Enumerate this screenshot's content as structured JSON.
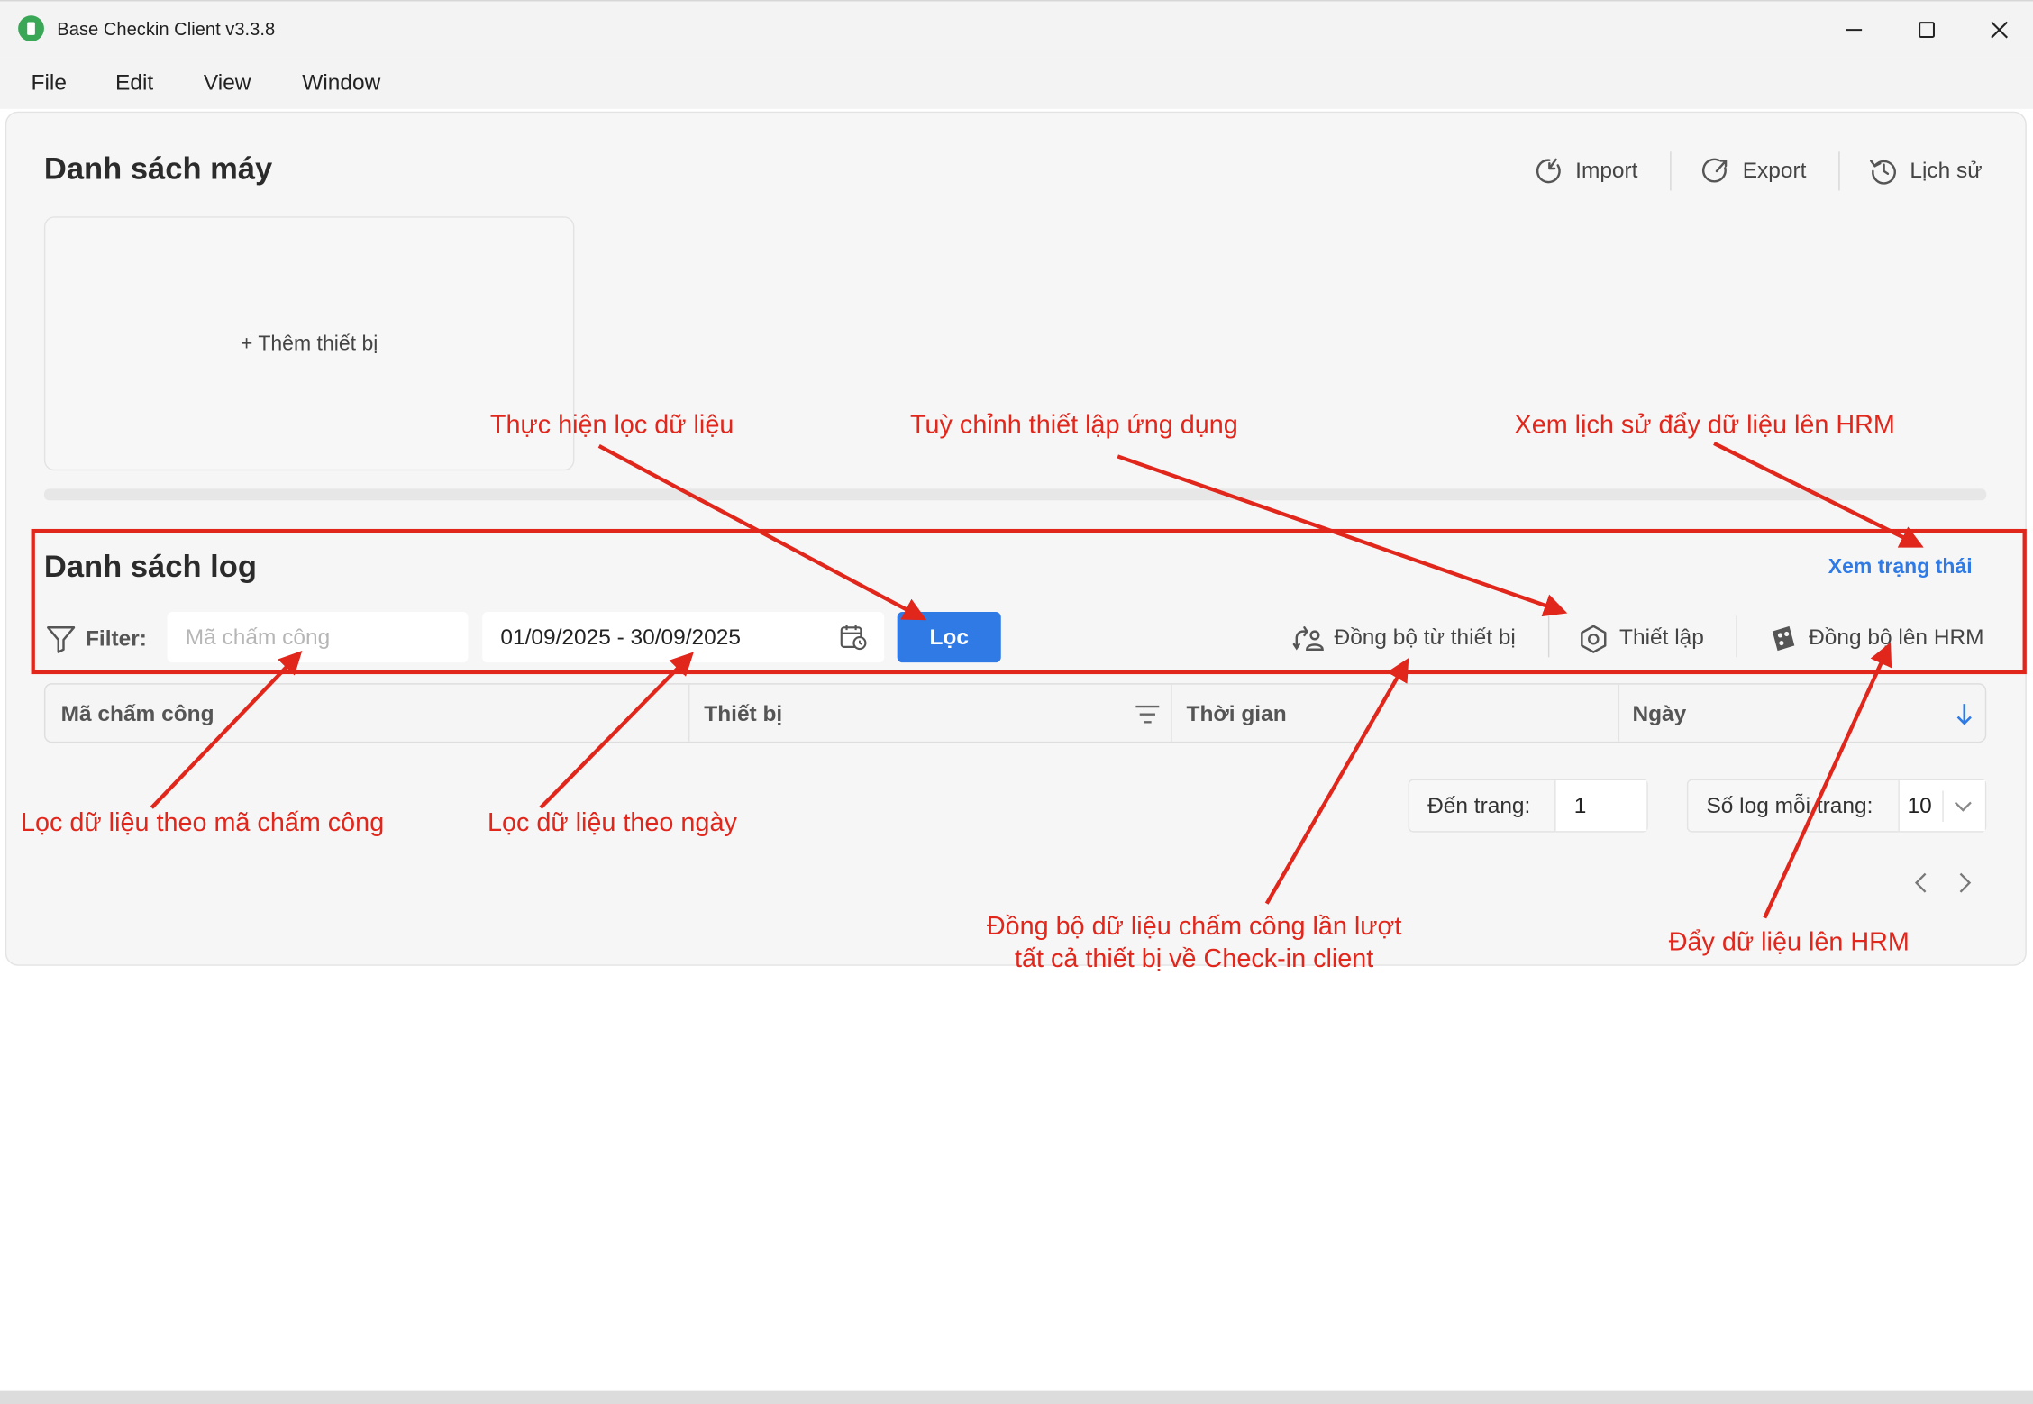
{
  "window": {
    "title": "Base Checkin Client v3.3.8"
  },
  "menu": [
    "File",
    "Edit",
    "View",
    "Window"
  ],
  "devices_section": {
    "title": "Danh sách máy",
    "actions": [
      {
        "label": "Import",
        "icon": "import-icon"
      },
      {
        "label": "Export",
        "icon": "export-icon"
      },
      {
        "label": "Lịch sử",
        "icon": "history-icon"
      }
    ],
    "add_device_label": "+ Thêm thiết bị"
  },
  "log_section": {
    "title": "Danh sách log",
    "view_status_link": "Xem trạng thái",
    "filter_label": "Filter:",
    "employee_code_placeholder": "Mã chấm công",
    "date_range_value": "01/09/2025 - 30/09/2025",
    "filter_button": "Lọc",
    "actions": [
      {
        "label": "Đồng bộ từ thiết bị",
        "icon": "sync-devices-icon"
      },
      {
        "label": "Thiết lập",
        "icon": "settings-hexagon-icon"
      },
      {
        "label": "Đồng bộ lên HRM",
        "icon": "upload-hrm-icon"
      }
    ]
  },
  "table": {
    "columns": [
      "Mã chấm công",
      "Thiết bị",
      "Thời gian",
      "Ngày"
    ]
  },
  "pagination": {
    "goto_label": "Đến trang:",
    "goto_value": "1",
    "per_page_label": "Số log mỗi trang:",
    "per_page_value": "10"
  },
  "annotations": {
    "filter_action": "Thực hiện lọc dữ liệu",
    "settings": "Tuỳ chỉnh thiết lập ứng dụng",
    "push_history": "Xem lịch sử đẩy dữ liệu lên HRM",
    "filter_by_code": "Lọc dữ liệu theo mã chấm công",
    "filter_by_date": "Lọc dữ liệu theo ngày",
    "sync_line1": "Đồng bộ dữ liệu chấm công lần lượt",
    "sync_line2": "tất cả thiết bị về Check-in client",
    "push_hrm": "Đẩy dữ liệu lên HRM"
  },
  "colors": {
    "accent": "#2f7ae5",
    "annotation": "#e1261c",
    "logo": "#3aa757"
  }
}
